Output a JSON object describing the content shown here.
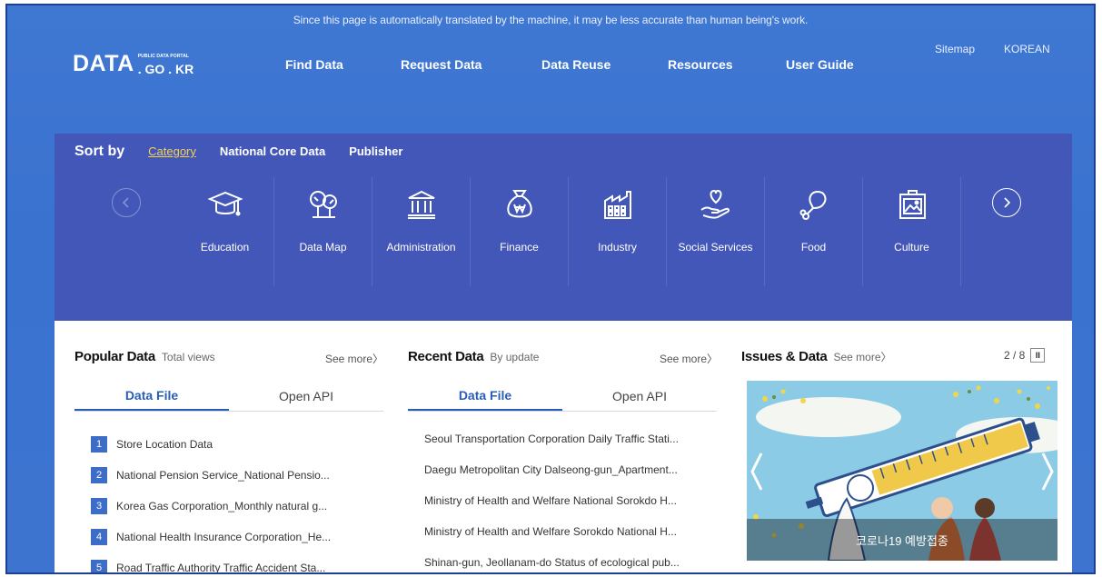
{
  "notice": "Since this page is automatically translated by the machine, it may be less accurate than human being's work.",
  "logo": {
    "main": "DATA",
    "small": "PUBLIC DATA PORTAL",
    "domain": ". GO . KR"
  },
  "nav": [
    "Find Data",
    "Request Data",
    "Data Reuse",
    "Resources",
    "User Guide"
  ],
  "util": {
    "sitemap": "Sitemap",
    "language": "KOREAN"
  },
  "sort": {
    "title": "Sort by",
    "options": [
      "Category",
      "National Core Data",
      "Publisher"
    ],
    "active": "Category"
  },
  "categories": [
    {
      "label": "Education",
      "icon": "graduation-cap-icon"
    },
    {
      "label": "Data Map",
      "icon": "tree-map-icon"
    },
    {
      "label": "Administration",
      "icon": "government-building-icon"
    },
    {
      "label": "Finance",
      "icon": "money-bag-icon"
    },
    {
      "label": "Industry",
      "icon": "factory-icon"
    },
    {
      "label": "Social Services",
      "icon": "heart-hand-icon"
    },
    {
      "label": "Food",
      "icon": "drumstick-icon"
    },
    {
      "label": "Culture",
      "icon": "gallery-frame-icon"
    }
  ],
  "popular": {
    "title": "Popular Data",
    "sub": "Total views",
    "see_more": "See more〉",
    "tabs": [
      "Data File",
      "Open API"
    ],
    "items": [
      "Store Location Data",
      "National Pension Service_National Pensio...",
      "Korea Gas Corporation_Monthly natural g...",
      "National Health Insurance Corporation_He...",
      "Road Traffic Authority Traffic Accident Sta..."
    ],
    "ranks": [
      "1",
      "2",
      "3",
      "4",
      "5"
    ]
  },
  "recent": {
    "title": "Recent Data",
    "sub": "By update",
    "see_more": "See more〉",
    "tabs": [
      "Data File",
      "Open API"
    ],
    "items": [
      "Seoul Transportation Corporation Daily Traffic Stati...",
      "Daegu Metropolitan City Dalseong-gun_Apartment...",
      "Ministry of Health and Welfare National Sorokdo H...",
      "Ministry of Health and Welfare Sorokdo National H...",
      "Shinan-gun, Jeollanam-do Status of ecological pub..."
    ]
  },
  "issues": {
    "title": "Issues & Data",
    "see_more": "See more〉",
    "pager": "2 / 8",
    "pause": "II",
    "caption": "코로나19 예방접종"
  }
}
